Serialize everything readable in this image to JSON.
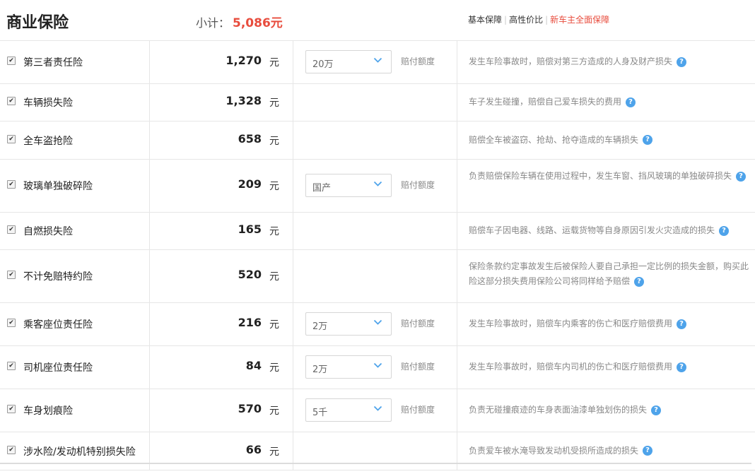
{
  "header": {
    "title": "商业保险",
    "subtotal_label": "小计：",
    "subtotal_value": "5,086",
    "subtotal_unit": "元",
    "plans": [
      "基本保障",
      "高性价比",
      "新车主全面保障"
    ]
  },
  "currency_unit": "元",
  "coverage_label": "赔付额度",
  "colors": {
    "accent": "#e84c3d",
    "help": "#4ea3ea"
  },
  "items": [
    {
      "name": "第三者责任险",
      "checked": true,
      "price": "1,270",
      "select": "20万",
      "desc": "发生车险事故时，赔偿对第三方造成的人身及财产损失"
    },
    {
      "name": "车辆损失险",
      "checked": true,
      "price": "1,328",
      "select": null,
      "desc": "车子发生碰撞，赔偿自己爱车损失的费用"
    },
    {
      "name": "全车盗抢险",
      "checked": true,
      "price": "658",
      "select": null,
      "desc": "赔偿全车被盗窃、抢劫、抢夺造成的车辆损失"
    },
    {
      "name": "玻璃单独破碎险",
      "checked": true,
      "price": "209",
      "select": "国产",
      "desc": "负责赔偿保险车辆在使用过程中，发生车窗、挡风玻璃的单独破碎损失"
    },
    {
      "name": "自燃损失险",
      "checked": true,
      "price": "165",
      "select": null,
      "desc": "赔偿车子因电器、线路、运载货物等自身原因引发火灾造成的损失"
    },
    {
      "name": "不计免赔特约险",
      "checked": true,
      "price": "520",
      "select": null,
      "desc": "保险条款约定事故发生后被保险人要自己承担一定比例的损失金额，购买此险这部分损失费用保险公司将同样给予赔偿"
    },
    {
      "name": "乘客座位责任险",
      "checked": true,
      "price": "216",
      "select": "2万",
      "desc": "发生车险事故时，赔偿车内乘客的伤亡和医疗赔偿费用"
    },
    {
      "name": "司机座位责任险",
      "checked": true,
      "price": "84",
      "select": "2万",
      "desc": "发生车险事故时，赔偿车内司机的伤亡和医疗赔偿费用"
    },
    {
      "name": "车身划痕险",
      "checked": true,
      "price": "570",
      "select": "5千",
      "desc": "负责无碰撞痕迹的车身表面油漆单独划伤的损失"
    },
    {
      "name": "涉水险/发动机特别损失险",
      "checked": true,
      "price": "66",
      "select": null,
      "desc": "负责爱车被水淹导致发动机受损所造成的损失"
    }
  ]
}
